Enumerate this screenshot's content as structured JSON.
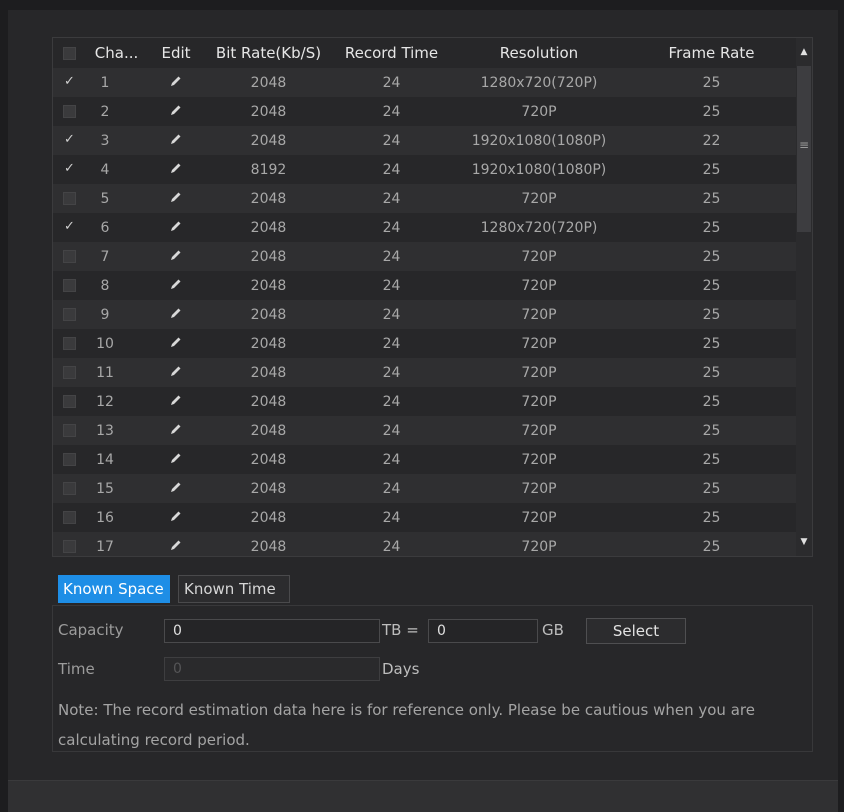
{
  "table": {
    "headers": {
      "channel": "Cha...",
      "edit": "Edit",
      "bitrate": "Bit Rate(Kb/S)",
      "record_time": "Record Time",
      "resolution": "Resolution",
      "frame_rate": "Frame Rate"
    },
    "rows": [
      {
        "checked": true,
        "channel": "1",
        "bitrate": "2048",
        "record_time": "24",
        "resolution": "1280x720(720P)",
        "frame_rate": "25"
      },
      {
        "checked": false,
        "channel": "2",
        "bitrate": "2048",
        "record_time": "24",
        "resolution": "720P",
        "frame_rate": "25"
      },
      {
        "checked": true,
        "channel": "3",
        "bitrate": "2048",
        "record_time": "24",
        "resolution": "1920x1080(1080P)",
        "frame_rate": "22"
      },
      {
        "checked": true,
        "channel": "4",
        "bitrate": "8192",
        "record_time": "24",
        "resolution": "1920x1080(1080P)",
        "frame_rate": "25"
      },
      {
        "checked": false,
        "channel": "5",
        "bitrate": "2048",
        "record_time": "24",
        "resolution": "720P",
        "frame_rate": "25"
      },
      {
        "checked": true,
        "channel": "6",
        "bitrate": "2048",
        "record_time": "24",
        "resolution": "1280x720(720P)",
        "frame_rate": "25"
      },
      {
        "checked": false,
        "channel": "7",
        "bitrate": "2048",
        "record_time": "24",
        "resolution": "720P",
        "frame_rate": "25"
      },
      {
        "checked": false,
        "channel": "8",
        "bitrate": "2048",
        "record_time": "24",
        "resolution": "720P",
        "frame_rate": "25"
      },
      {
        "checked": false,
        "channel": "9",
        "bitrate": "2048",
        "record_time": "24",
        "resolution": "720P",
        "frame_rate": "25"
      },
      {
        "checked": false,
        "channel": "10",
        "bitrate": "2048",
        "record_time": "24",
        "resolution": "720P",
        "frame_rate": "25"
      },
      {
        "checked": false,
        "channel": "11",
        "bitrate": "2048",
        "record_time": "24",
        "resolution": "720P",
        "frame_rate": "25"
      },
      {
        "checked": false,
        "channel": "12",
        "bitrate": "2048",
        "record_time": "24",
        "resolution": "720P",
        "frame_rate": "25"
      },
      {
        "checked": false,
        "channel": "13",
        "bitrate": "2048",
        "record_time": "24",
        "resolution": "720P",
        "frame_rate": "25"
      },
      {
        "checked": false,
        "channel": "14",
        "bitrate": "2048",
        "record_time": "24",
        "resolution": "720P",
        "frame_rate": "25"
      },
      {
        "checked": false,
        "channel": "15",
        "bitrate": "2048",
        "record_time": "24",
        "resolution": "720P",
        "frame_rate": "25"
      },
      {
        "checked": false,
        "channel": "16",
        "bitrate": "2048",
        "record_time": "24",
        "resolution": "720P",
        "frame_rate": "25"
      },
      {
        "checked": false,
        "channel": "17",
        "bitrate": "2048",
        "record_time": "24",
        "resolution": "720P",
        "frame_rate": "25"
      }
    ]
  },
  "icons": {
    "row_edit": "pencil-icon",
    "check": "checkmark-icon",
    "scroll_up": "caret-up-icon",
    "scroll_down": "caret-down-icon",
    "scroll_grip": "grip-lines-icon"
  },
  "glyphs": {
    "check": "✓",
    "up": "▲",
    "down": "▼",
    "grip": "≡"
  },
  "tabs": {
    "known_space": "Known Space",
    "known_time": "Known Time",
    "active": "Known Space"
  },
  "form": {
    "capacity_label": "Capacity",
    "capacity_value": "0",
    "tb_unit": "TB =",
    "gb_value": "0",
    "gb_unit": "GB",
    "select_label": "Select",
    "time_label": "Time",
    "time_placeholder": "0",
    "days_unit": "Days",
    "note": "Note: The record estimation data here is for reference only. Please be cautious when you are calculating record period."
  },
  "colors": {
    "accent": "#1e8ee6",
    "background": "#272729"
  }
}
